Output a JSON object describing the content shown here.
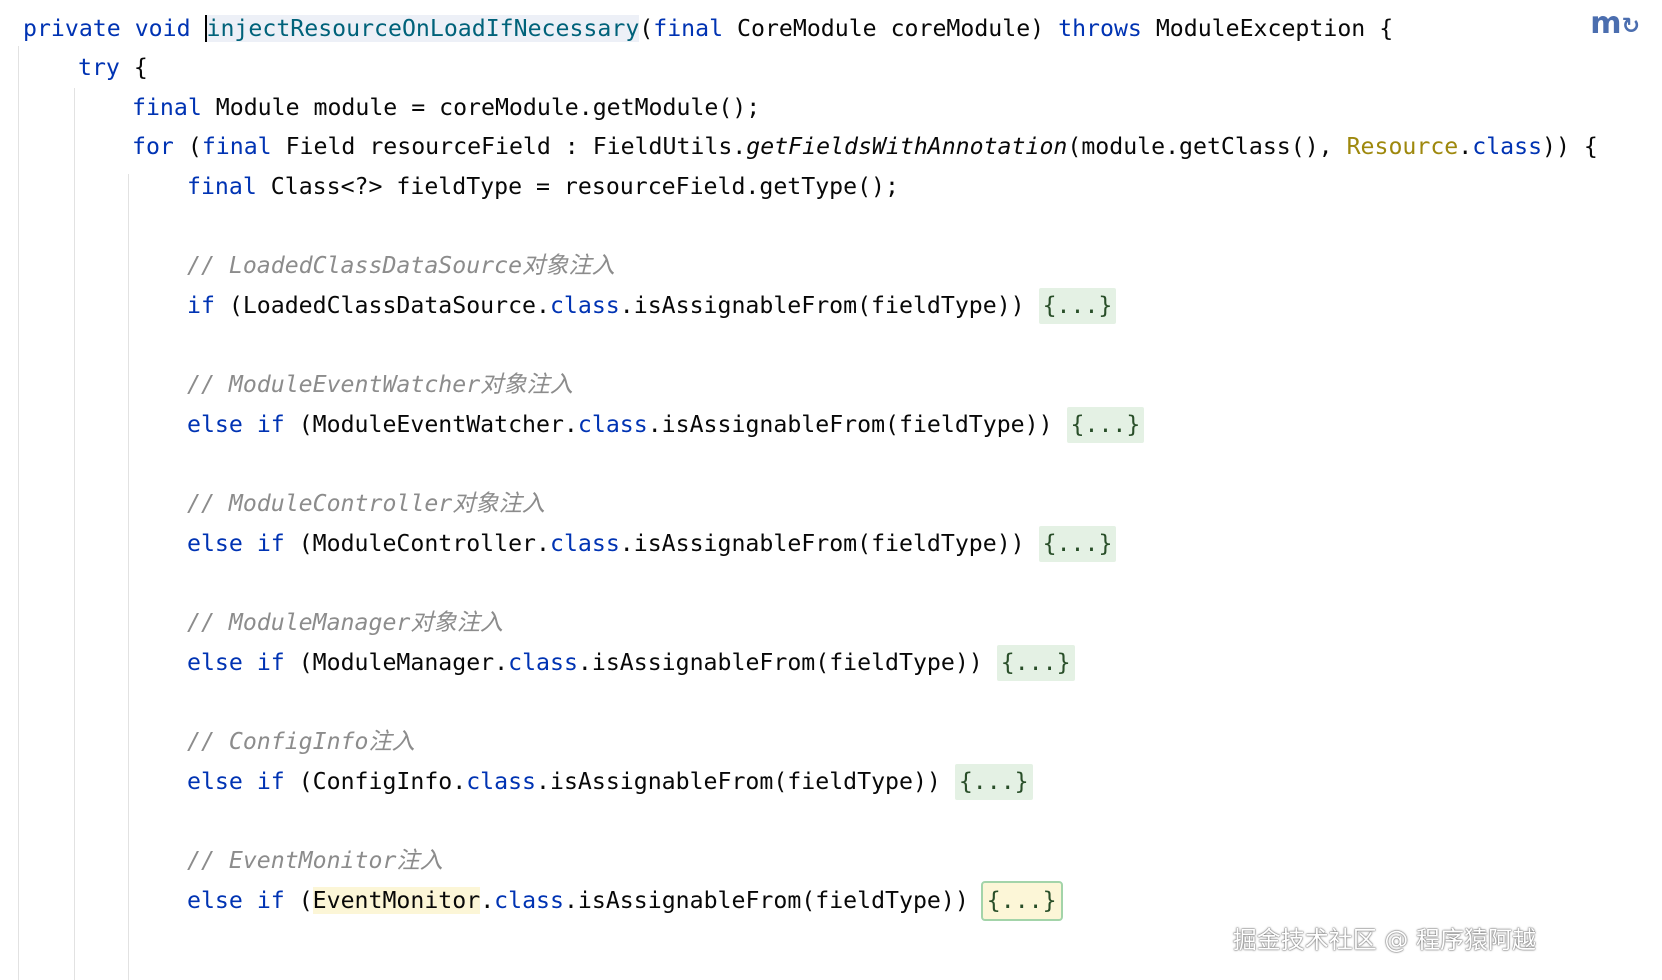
{
  "code": {
    "line1": {
      "kw_private": "private",
      "kw_void": "void",
      "method_name": "injectResourceOnLoadIfNecessary",
      "paren_open": "(",
      "kw_final": "final",
      "params": " CoreModule coreModule) ",
      "kw_throws": "throws",
      "rest": " ModuleException {"
    },
    "line2": {
      "kw_try": "try",
      "rest": " {"
    },
    "line3": {
      "kw_final": "final",
      "rest": " Module module = coreModule.getModule();"
    },
    "line4": {
      "kw_for": "for",
      "part1": " (",
      "kw_final": "final",
      "part2": " Field resourceField : FieldUtils.",
      "method_italic": "getFieldsWithAnnotation",
      "part3": "(module.getClass(), ",
      "annotation": "Resource",
      "dot": ".",
      "kw_class": "class",
      "rest": ")) {"
    },
    "line5": {
      "kw_final": "final",
      "rest": " Class<?> fieldType = resourceField.getType();"
    },
    "comment1": "// LoadedClassDataSource对象注入",
    "if1": {
      "kw_if": "if",
      "part1": " (LoadedClassDataSource.",
      "kw_class": "class",
      "part2": ".isAssignableFrom(fieldType)) ",
      "fold": "{...}"
    },
    "comment2": "// ModuleEventWatcher对象注入",
    "if2": {
      "kw_else": "else",
      "kw_if": "if",
      "part1": " (ModuleEventWatcher.",
      "kw_class": "class",
      "part2": ".isAssignableFrom(fieldType)) ",
      "fold": "{...}"
    },
    "comment3": "// ModuleController对象注入",
    "if3": {
      "kw_else": "else",
      "kw_if": "if",
      "part1": " (ModuleController.",
      "kw_class": "class",
      "part2": ".isAssignableFrom(fieldType)) ",
      "fold": "{...}"
    },
    "comment4": "// ModuleManager对象注入",
    "if4": {
      "kw_else": "else",
      "kw_if": "if",
      "part1": " (ModuleManager.",
      "kw_class": "class",
      "part2": ".isAssignableFrom(fieldType)) ",
      "fold": "{...}"
    },
    "comment5": "// ConfigInfo注入",
    "if5": {
      "kw_else": "else",
      "kw_if": "if",
      "part1": " (ConfigInfo.",
      "kw_class": "class",
      "part2": ".isAssignableFrom(fieldType)) ",
      "fold": "{...}"
    },
    "comment6": "// EventMonitor注入",
    "if6": {
      "kw_else": "else",
      "kw_if": "if",
      "part0": " (",
      "ref": "EventMonitor",
      "part1": ".",
      "kw_class": "class",
      "part2": ".isAssignableFrom(fieldType)) ",
      "fold": "{...}"
    }
  },
  "logo_icon": "plugin-logo-icon",
  "watermark": "掘金技术社区 @ 程序猿阿越"
}
